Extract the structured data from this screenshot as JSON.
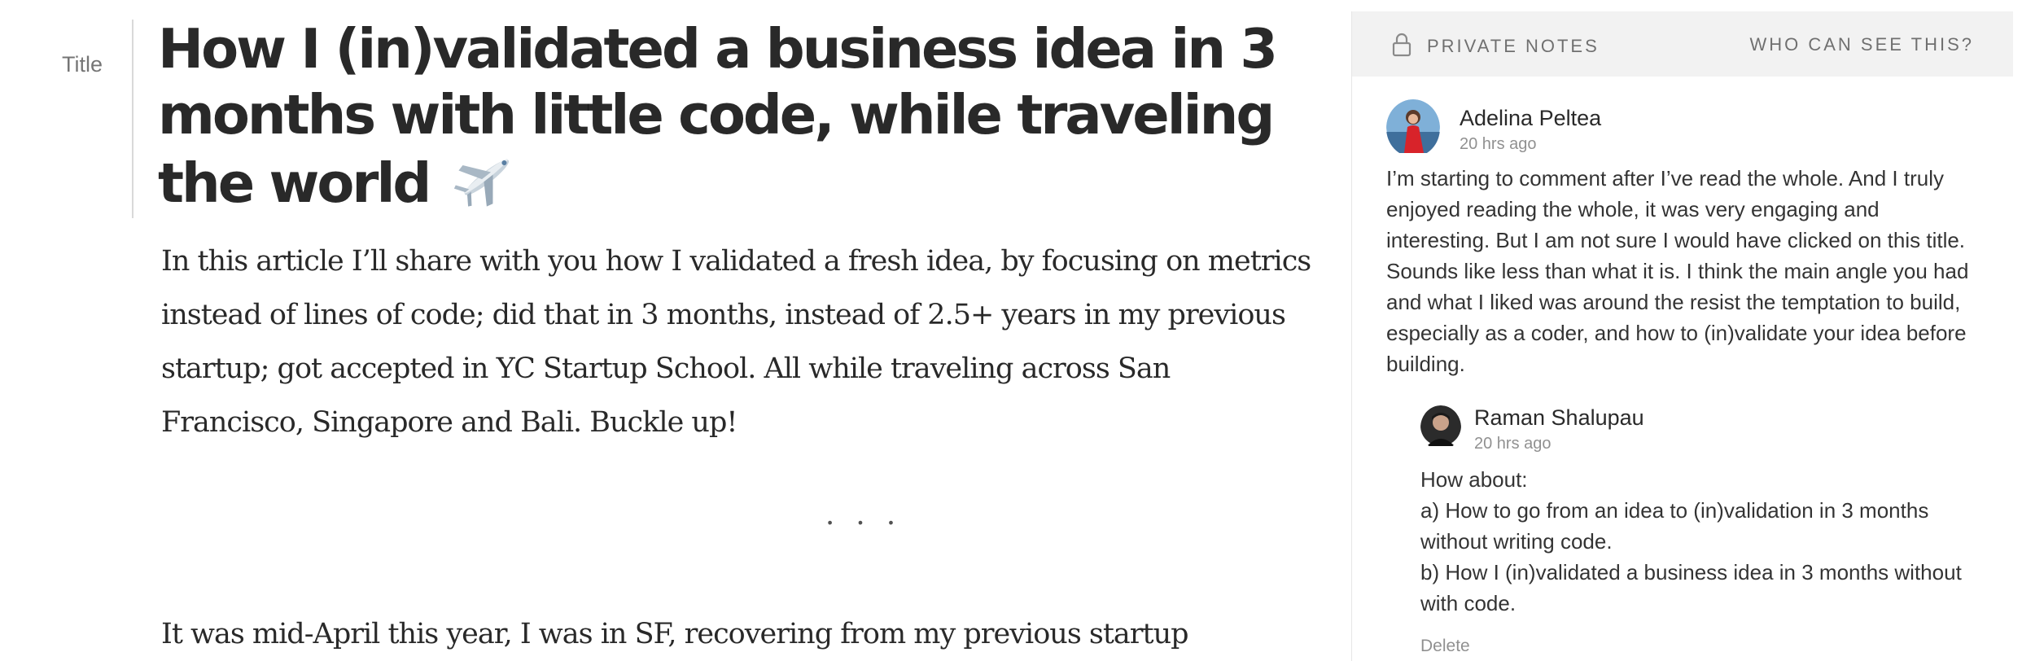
{
  "editor": {
    "section_label": "Title",
    "title": "How I (in)validated a business idea in 3 months with little code, while traveling the world",
    "intro": "In this article I’ll share with you how I validated a fresh idea, by focusing on metrics instead of lines of code; did that in 3 months, instead of 2.5+ years in my previous startup; got accepted in YC Startup School. All while traveling across San Francisco, Singapore and Bali. Buckle up!",
    "separator": "...",
    "body_first_line": "It was mid-April this year, I was in SF, recovering from my previous startup"
  },
  "notes": {
    "header_title": "PRIVATE NOTES",
    "who_can_see": "WHO CAN SEE THIS?",
    "comments": [
      {
        "author": "Adelina Peltea",
        "time": "20 hrs ago",
        "text": "I’m starting to comment after I’ve read the whole. And I truly enjoyed reading the whole, it was very engaging and interesting. But I am not sure I would have clicked on this title. Sounds like less than what it is. I think the main angle you had and what I liked was around the resist the temptation to build, especially as a coder, and how to (in)validate your idea before building."
      },
      {
        "author": "Raman Shalupau",
        "time": "20 hrs ago",
        "lines": [
          "How about:",
          "a) How to go from an idea to (in)validation in 3 months without writing code.",
          "b) How I (in)validated a business idea in 3 months without with code."
        ],
        "delete_label": "Delete"
      }
    ]
  },
  "icons": {
    "lock": "lock-icon",
    "plane": "airplane-icon"
  },
  "colors": {
    "panel_header_bg": "#f2f2f2",
    "text_primary": "#292929",
    "text_muted": "#8a8a8a"
  }
}
